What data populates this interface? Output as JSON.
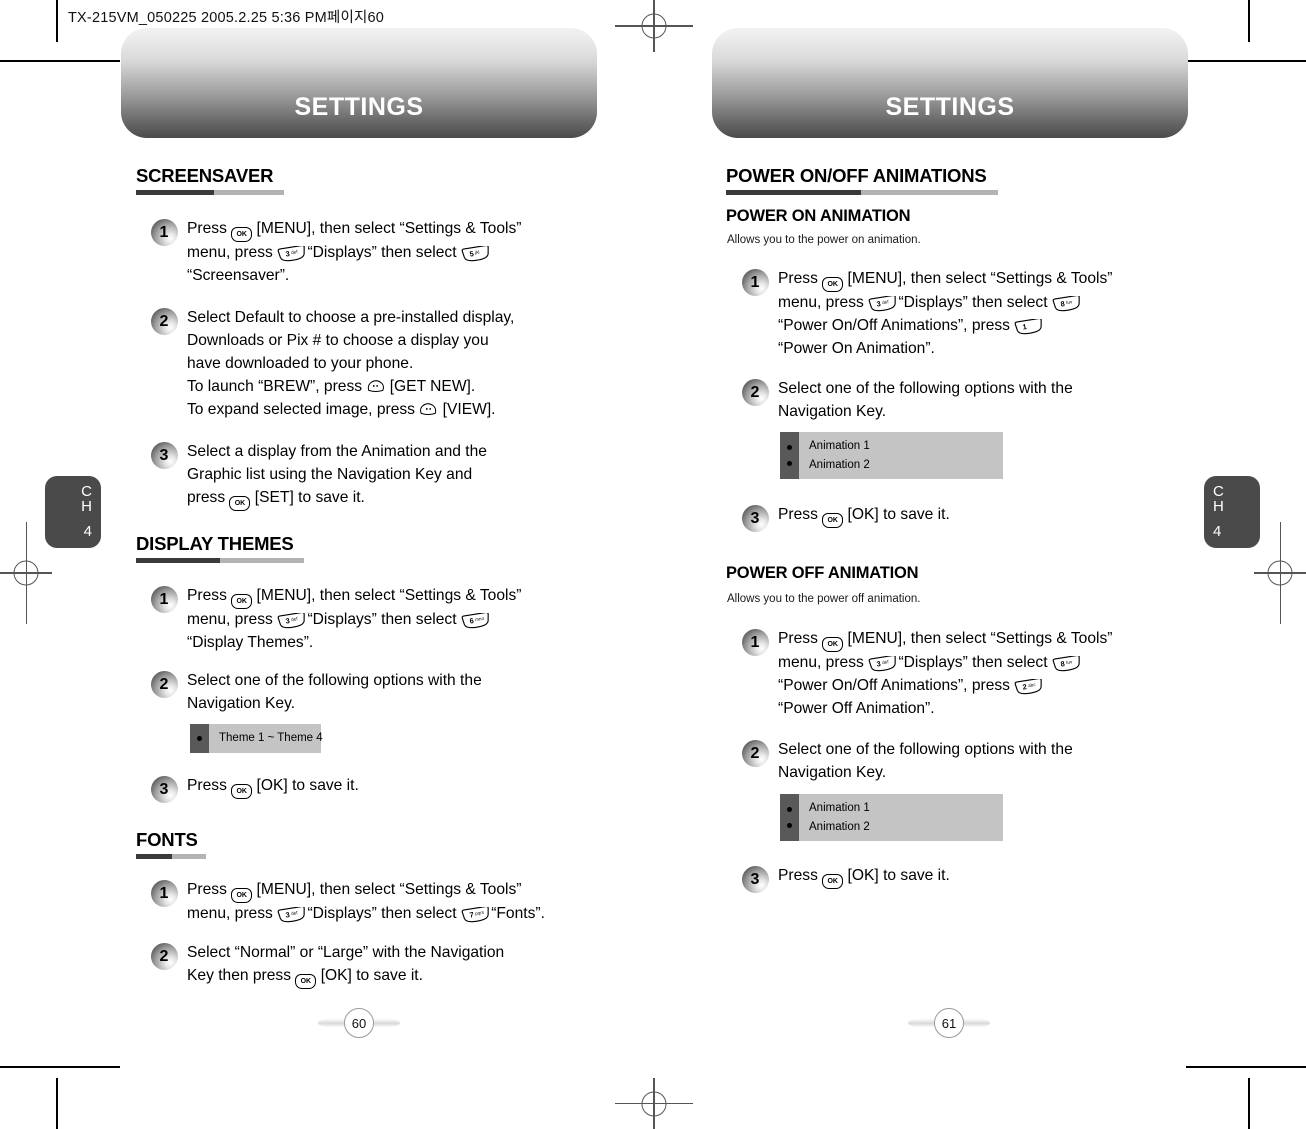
{
  "print_slug": "TX-215VM_050225  2005.2.25 5:36 PM페이지60",
  "chapter_tab": {
    "c": "C",
    "h": "H",
    "number": "4"
  },
  "colors": {
    "banner_top": "#f2f2f2",
    "banner_bottom": "#4b4b4b",
    "rule_dark": "#3a3a3a",
    "rule_light": "#b3b3b3",
    "option_bullet_bg": "#595959",
    "option_item_bg": "#c4c4c4",
    "chapter_tab_bg": "#4a4a4a"
  },
  "left_page": {
    "banner_title": "SETTINGS",
    "page_number": "60",
    "sections": [
      {
        "heading": "SCREENSAVER",
        "steps": [
          {
            "number": "1",
            "lines": [
              [
                {
                  "t": "text",
                  "v": "Press "
                },
                {
                  "t": "key",
                  "kind": "ok",
                  "v": "OK"
                },
                {
                  "t": "text",
                  "v": " [MENU], then select “Settings & Tools”"
                }
              ],
              [
                {
                  "t": "text",
                  "v": "menu, press "
                },
                {
                  "t": "key",
                  "kind": "num",
                  "v": "3",
                  "sub": "def"
                },
                {
                  "t": "text",
                  "v": " “Displays” then select "
                },
                {
                  "t": "key",
                  "kind": "num",
                  "v": "5",
                  "sub": "jkl"
                }
              ],
              [
                {
                  "t": "text",
                  "v": "“Screensaver”."
                }
              ]
            ]
          },
          {
            "number": "2",
            "lines": [
              [
                {
                  "t": "text",
                  "v": "Select Default to choose a pre-installed display,"
                }
              ],
              [
                {
                  "t": "text",
                  "v": "Downloads or Pix # to choose a display you"
                }
              ],
              [
                {
                  "t": "text",
                  "v": "have downloaded to your phone."
                }
              ],
              [
                {
                  "t": "text",
                  "v": "To launch “BREW”, press "
                },
                {
                  "t": "key",
                  "kind": "soft-left",
                  "v": ""
                },
                {
                  "t": "text",
                  "v": " [GET NEW]."
                }
              ],
              [
                {
                  "t": "text",
                  "v": "To expand selected image, press "
                },
                {
                  "t": "key",
                  "kind": "soft-right",
                  "v": ""
                },
                {
                  "t": "text",
                  "v": " [VIEW]."
                }
              ]
            ]
          },
          {
            "number": "3",
            "lines": [
              [
                {
                  "t": "text",
                  "v": "Select a display from the Animation and the"
                }
              ],
              [
                {
                  "t": "text",
                  "v": "Graphic list using the Navigation Key and"
                }
              ],
              [
                {
                  "t": "text",
                  "v": "press "
                },
                {
                  "t": "key",
                  "kind": "ok",
                  "v": "OK"
                },
                {
                  "t": "text",
                  "v": " [SET] to save it."
                }
              ]
            ]
          }
        ]
      },
      {
        "heading": "DISPLAY THEMES",
        "steps": [
          {
            "number": "1",
            "lines": [
              [
                {
                  "t": "text",
                  "v": "Press "
                },
                {
                  "t": "key",
                  "kind": "ok",
                  "v": "OK"
                },
                {
                  "t": "text",
                  "v": " [MENU], then select “Settings & Tools”"
                }
              ],
              [
                {
                  "t": "text",
                  "v": "menu, press "
                },
                {
                  "t": "key",
                  "kind": "num",
                  "v": "3",
                  "sub": "def"
                },
                {
                  "t": "text",
                  "v": " “Displays” then select "
                },
                {
                  "t": "key",
                  "kind": "num",
                  "v": "6",
                  "sub": "mno"
                }
              ],
              [
                {
                  "t": "text",
                  "v": "“Display Themes”."
                }
              ]
            ]
          },
          {
            "number": "2",
            "lines": [
              [
                {
                  "t": "text",
                  "v": "Select one of the following options with the"
                }
              ],
              [
                {
                  "t": "text",
                  "v": "Navigation Key."
                }
              ]
            ],
            "options": [
              "Theme 1 ~ Theme 4"
            ]
          },
          {
            "number": "3",
            "lines": [
              [
                {
                  "t": "text",
                  "v": "Press "
                },
                {
                  "t": "key",
                  "kind": "ok",
                  "v": "OK"
                },
                {
                  "t": "text",
                  "v": " [OK] to save it."
                }
              ]
            ]
          }
        ]
      },
      {
        "heading": "FONTS",
        "steps": [
          {
            "number": "1",
            "lines": [
              [
                {
                  "t": "text",
                  "v": "Press "
                },
                {
                  "t": "key",
                  "kind": "ok",
                  "v": "OK"
                },
                {
                  "t": "text",
                  "v": " [MENU], then select “Settings & Tools”"
                }
              ],
              [
                {
                  "t": "text",
                  "v": "menu, press "
                },
                {
                  "t": "key",
                  "kind": "num",
                  "v": "3",
                  "sub": "def"
                },
                {
                  "t": "text",
                  "v": " “Displays” then select "
                },
                {
                  "t": "key",
                  "kind": "num",
                  "v": "7",
                  "sub": "pqrs"
                },
                {
                  "t": "text",
                  "v": " “Fonts”."
                }
              ]
            ]
          },
          {
            "number": "2",
            "lines": [
              [
                {
                  "t": "text",
                  "v": "Select “Normal” or “Large” with the Navigation"
                }
              ],
              [
                {
                  "t": "text",
                  "v": "Key then press "
                },
                {
                  "t": "key",
                  "kind": "ok",
                  "v": "OK"
                },
                {
                  "t": "text",
                  "v": " [OK] to save it."
                }
              ]
            ]
          }
        ]
      }
    ]
  },
  "right_page": {
    "banner_title": "SETTINGS",
    "page_number": "61",
    "section_heading": "POWER ON/OFF ANIMATIONS",
    "subsections": [
      {
        "title": "POWER ON ANIMATION",
        "description": "Allows you to the power on animation.",
        "steps": [
          {
            "number": "1",
            "lines": [
              [
                {
                  "t": "text",
                  "v": "Press "
                },
                {
                  "t": "key",
                  "kind": "ok",
                  "v": "OK"
                },
                {
                  "t": "text",
                  "v": " [MENU], then select “Settings & Tools”"
                }
              ],
              [
                {
                  "t": "text",
                  "v": "menu, press "
                },
                {
                  "t": "key",
                  "kind": "num",
                  "v": "3",
                  "sub": "def"
                },
                {
                  "t": "text",
                  "v": " “Displays” then select "
                },
                {
                  "t": "key",
                  "kind": "num",
                  "v": "8",
                  "sub": "tuv"
                }
              ],
              [
                {
                  "t": "text",
                  "v": "“Power On/Off Animations”, press "
                },
                {
                  "t": "key",
                  "kind": "num",
                  "v": "1",
                  "sub": ""
                }
              ],
              [
                {
                  "t": "text",
                  "v": "“Power On Animation”."
                }
              ]
            ]
          },
          {
            "number": "2",
            "lines": [
              [
                {
                  "t": "text",
                  "v": "Select one of the following options with the"
                }
              ],
              [
                {
                  "t": "text",
                  "v": "Navigation Key."
                }
              ]
            ],
            "options": [
              "Animation 1",
              "Animation 2"
            ]
          },
          {
            "number": "3",
            "lines": [
              [
                {
                  "t": "text",
                  "v": "Press "
                },
                {
                  "t": "key",
                  "kind": "ok",
                  "v": "OK"
                },
                {
                  "t": "text",
                  "v": " [OK] to save it."
                }
              ]
            ]
          }
        ]
      },
      {
        "title": "POWER OFF ANIMATION",
        "description": "Allows you to the power off animation.",
        "steps": [
          {
            "number": "1",
            "lines": [
              [
                {
                  "t": "text",
                  "v": "Press "
                },
                {
                  "t": "key",
                  "kind": "ok",
                  "v": "OK"
                },
                {
                  "t": "text",
                  "v": " [MENU], then select “Settings & Tools”"
                }
              ],
              [
                {
                  "t": "text",
                  "v": "menu, press "
                },
                {
                  "t": "key",
                  "kind": "num",
                  "v": "3",
                  "sub": "def"
                },
                {
                  "t": "text",
                  "v": " “Displays” then select "
                },
                {
                  "t": "key",
                  "kind": "num",
                  "v": "8",
                  "sub": "tuv"
                }
              ],
              [
                {
                  "t": "text",
                  "v": "“Power On/Off Animations”, press "
                },
                {
                  "t": "key",
                  "kind": "num",
                  "v": "2",
                  "sub": "abc"
                }
              ],
              [
                {
                  "t": "text",
                  "v": "“Power Off  Animation”."
                }
              ]
            ]
          },
          {
            "number": "2",
            "lines": [
              [
                {
                  "t": "text",
                  "v": "Select one of the following options with the"
                }
              ],
              [
                {
                  "t": "text",
                  "v": "Navigation Key."
                }
              ]
            ],
            "options": [
              "Animation 1",
              "Animation 2"
            ]
          },
          {
            "number": "3",
            "lines": [
              [
                {
                  "t": "text",
                  "v": "Press "
                },
                {
                  "t": "key",
                  "kind": "ok",
                  "v": "OK"
                },
                {
                  "t": "text",
                  "v": " [OK] to save it."
                }
              ]
            ]
          }
        ]
      }
    ]
  }
}
